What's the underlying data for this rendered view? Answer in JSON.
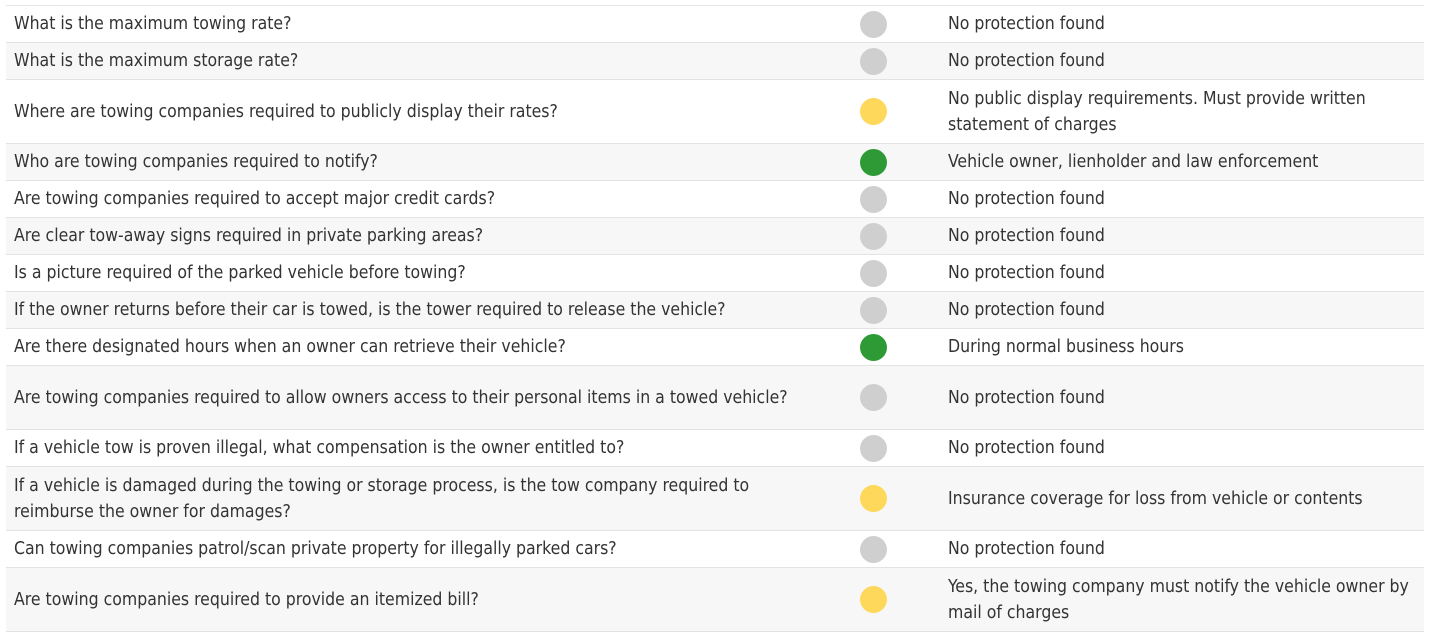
{
  "status_colors": {
    "gray": "#cfcfcf",
    "yellow": "#fdd85a",
    "green": "#2e9a36"
  },
  "rows": [
    {
      "question": "What is the maximum towing rate?",
      "status": "gray",
      "answer": "No protection found"
    },
    {
      "question": "What is the maximum storage rate?",
      "status": "gray",
      "answer": "No protection found"
    },
    {
      "question": "Where are towing companies required to publicly display their rates?",
      "status": "yellow",
      "answer": "No public display requirements. Must provide written statement of charges"
    },
    {
      "question": "Who are towing companies required to notify?",
      "status": "green",
      "answer": "Vehicle owner, lienholder and law enforcement"
    },
    {
      "question": "Are towing companies required to accept major credit cards?",
      "status": "gray",
      "answer": "No protection found"
    },
    {
      "question": "Are clear tow-away signs required in private parking areas?",
      "status": "gray",
      "answer": "No protection found"
    },
    {
      "question": "Is a picture required of the parked vehicle before towing?",
      "status": "gray",
      "answer": "No protection found"
    },
    {
      "question": "If the owner returns before their car is towed, is the tower required to release the vehicle?",
      "status": "gray",
      "answer": "No protection found"
    },
    {
      "question": "Are there designated hours when an owner can retrieve their vehicle?",
      "status": "green",
      "answer": "During normal business hours"
    },
    {
      "question": "Are towing companies required to allow owners access to their personal items in a towed vehicle?",
      "status": "gray",
      "answer": "No protection found"
    },
    {
      "question": "If a vehicle tow is proven illegal, what compensation is the owner entitled to?",
      "status": "gray",
      "answer": "No protection found"
    },
    {
      "question": "If a vehicle is damaged during the towing or storage process, is the tow company required to reimburse the owner for damages?",
      "status": "yellow",
      "answer": "Insurance coverage for loss from vehicle or contents"
    },
    {
      "question": "Can towing companies patrol/scan private property for illegally parked cars?",
      "status": "gray",
      "answer": "No protection found"
    },
    {
      "question": "Are towing companies required to provide an itemized bill?",
      "status": "yellow",
      "answer": "Yes, the towing company must notify the vehicle owner by mail of charges"
    }
  ]
}
